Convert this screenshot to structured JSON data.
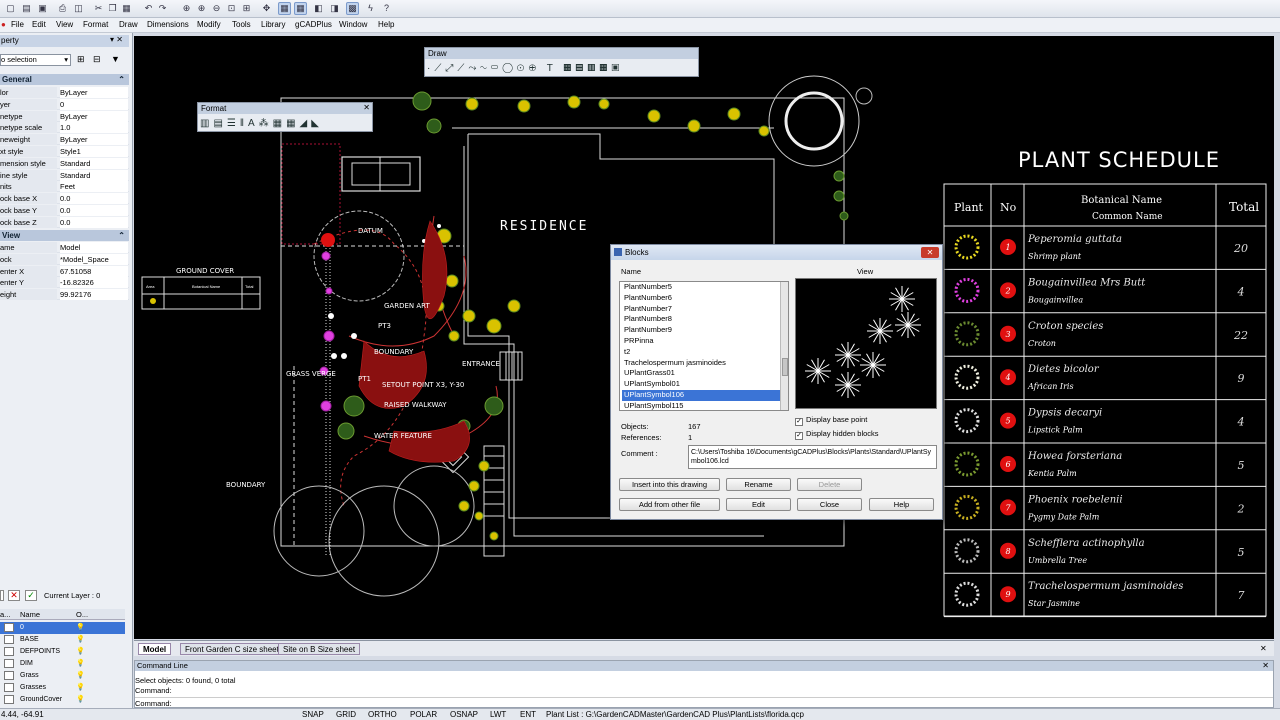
{
  "menu": [
    "File",
    "Edit",
    "View",
    "Format",
    "Draw",
    "Dimensions",
    "Modify",
    "Tools",
    "Library",
    "gCADPlus",
    "Window",
    "Help"
  ],
  "properties": {
    "title": "perty",
    "selection": "o selection",
    "general_header": "General",
    "general": [
      {
        "k": "lor",
        "v": "ByLayer"
      },
      {
        "k": "yer",
        "v": "0"
      },
      {
        "k": "netype",
        "v": "ByLayer"
      },
      {
        "k": "netype scale",
        "v": "1.0"
      },
      {
        "k": "neweight",
        "v": "ByLayer"
      },
      {
        "k": "xt style",
        "v": "Style1"
      },
      {
        "k": "mension style",
        "v": "Standard"
      },
      {
        "k": "ine style",
        "v": "Standard"
      },
      {
        "k": "nits",
        "v": "Feet"
      },
      {
        "k": "ock base X",
        "v": "0.0"
      },
      {
        "k": "ock base Y",
        "v": "0.0"
      },
      {
        "k": "ock base Z",
        "v": "0.0"
      }
    ],
    "view_header": "View",
    "view": [
      {
        "k": "ame",
        "v": "Model"
      },
      {
        "k": "ock",
        "v": "*Model_Space"
      },
      {
        "k": "enter X",
        "v": "67.51058"
      },
      {
        "k": "enter Y",
        "v": "-16.82326"
      },
      {
        "k": "eight",
        "v": "99.92176"
      }
    ]
  },
  "layers": {
    "current": "Current Layer : 0",
    "col_name": "Name",
    "col_on": "O...",
    "col_a": "a...",
    "items": [
      "0",
      "BASE",
      "DEFPOINTS",
      "DIM",
      "Grass",
      "Grasses",
      "GroundCover"
    ]
  },
  "toolbars": {
    "draw": "Draw",
    "format": "Format"
  },
  "drawing": {
    "residence": "RESIDENCE",
    "labels": [
      "DATUM",
      "GARDEN ART",
      "PT3",
      "BOUNDARY",
      "ENTRANCE",
      "GRASS VERGE",
      "PT1",
      "SETOUT POINT X3, Y-30",
      "RAISED WALKWAY",
      "WATER FEATURE",
      "BOUNDARY"
    ],
    "ground_cover_title": "GROUND COVER",
    "ground_cover_cols": [
      "Area",
      "Botanical Name",
      "Total"
    ]
  },
  "schedule": {
    "title": "PLANT SCHEDULE",
    "headers": {
      "plant": "Plant",
      "no": "No",
      "bot": "Botanical Name",
      "common": "Common Name",
      "total": "Total"
    },
    "rows": [
      {
        "no": "1",
        "bot": "Peperomia guttata",
        "common": "Shrimp plant",
        "total": "20"
      },
      {
        "no": "2",
        "bot": "Bougainvillea Mrs Butt",
        "common": "Bougainvillea",
        "total": "4"
      },
      {
        "no": "3",
        "bot": "Croton species",
        "common": "Croton",
        "total": "22"
      },
      {
        "no": "4",
        "bot": "Dietes bicolor",
        "common": "African Iris",
        "total": "9"
      },
      {
        "no": "5",
        "bot": "Dypsis decaryi",
        "common": "Lipstick Palm",
        "total": "4"
      },
      {
        "no": "6",
        "bot": "Howea forsteriana",
        "common": "Kentia Palm",
        "total": "5"
      },
      {
        "no": "7",
        "bot": "Phoenix roebelenii",
        "common": "Pygmy Date Palm",
        "total": "2"
      },
      {
        "no": "8",
        "bot": "Schefflera actinophylla",
        "common": "Umbrella Tree",
        "total": "5"
      },
      {
        "no": "9",
        "bot": "Trachelospermum jasminoides",
        "common": "Star Jasmine",
        "total": "7"
      }
    ]
  },
  "blocks_dialog": {
    "title": "Blocks",
    "name_col": "Name",
    "view_col": "View",
    "items": [
      "PlantNumber5",
      "PlantNumber6",
      "PlantNumber7",
      "PlantNumber8",
      "PlantNumber9",
      "PRPinna",
      "t2",
      "Trachelospermum jasminoides",
      "UPlantGrass01",
      "UPlantSymbol01",
      "UPlantSymbol106",
      "UPlantSymbol115"
    ],
    "selected": "UPlantSymbol106",
    "display_base_point": "Display base point",
    "display_hidden_blocks": "Display hidden blocks",
    "objects_label": "Objects:",
    "objects_value": "167",
    "references_label": "References:",
    "references_value": "1",
    "comment_label": "Comment :",
    "comment_value": "C:\\Users\\Toshiba 16\\Documents\\gCADPlus\\Blocks\\Plants\\Standard\\UPlantSymbol106.lcd",
    "buttons": {
      "insert": "Insert into this drawing",
      "rename": "Rename",
      "delete": "Delete",
      "add": "Add from other file",
      "edit": "Edit",
      "close": "Close",
      "help": "Help"
    }
  },
  "tabs": [
    "Model",
    "Front Garden C size sheet",
    "Site on B Size sheet"
  ],
  "command": {
    "title": "Command Line",
    "lines": [
      "Select objects: 0 found,  0 total",
      "Command:"
    ],
    "prompt": "Command:"
  },
  "status": {
    "coords": "4.44,  -64.91",
    "toggles": [
      "SNAP",
      "GRID",
      "ORTHO",
      "POLAR",
      "OSNAP",
      "LWT",
      "ENT"
    ],
    "plant_list": "Plant List : G:\\GardenCADMaster\\GardenCAD Plus\\PlantLists\\florida.qcp"
  },
  "colors": {
    "cad_bg": "#000000",
    "red_marker": "#e01010",
    "hatch": "#b01010",
    "selection": "#3b74d6"
  }
}
